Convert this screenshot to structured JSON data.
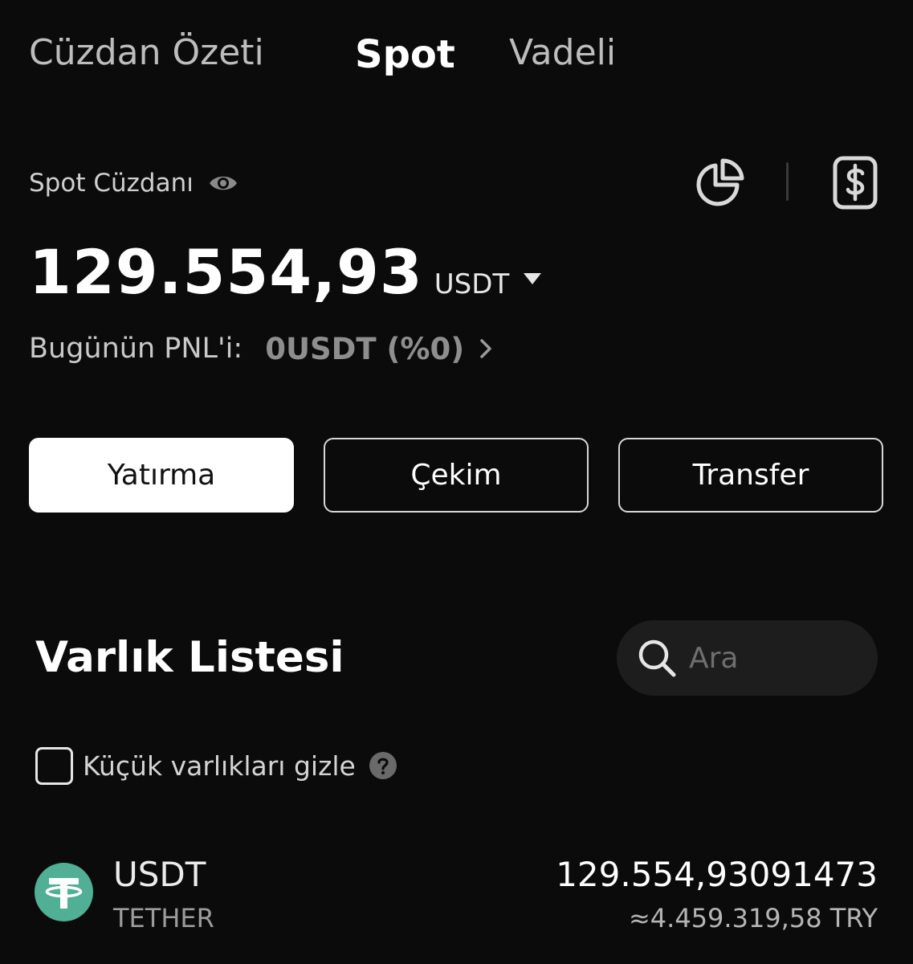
{
  "tabs": [
    {
      "label": "Cüzdan Özeti",
      "active": false
    },
    {
      "label": "Spot",
      "active": true
    },
    {
      "label": "Vadeli",
      "active": false
    }
  ],
  "wallet": {
    "title": "Spot Cüzdanı",
    "balance": "129.554,93",
    "currency": "USDT",
    "pnl_label": "Bugünün PNL'i:",
    "pnl_value": "0USDT (%0)"
  },
  "actions": {
    "deposit": "Yatırma",
    "withdraw": "Çekim",
    "transfer": "Transfer"
  },
  "assets_section": {
    "title": "Varlık Listesi",
    "search_placeholder": "Ara",
    "hide_small_label": "Küçük varlıkları gizle",
    "hide_small_checked": false
  },
  "assets": [
    {
      "symbol": "USDT",
      "name": "TETHER",
      "amount": "129.554,93091473",
      "fiat_value": "≈4.459.319,58 TRY",
      "icon": "tether-icon",
      "icon_color": "#50af95"
    }
  ],
  "icons": {
    "visibility": "eye-icon",
    "portfolio_chart": "pie-chart-icon",
    "balance_card": "dollar-card-icon",
    "currency_select": "caret-down-icon",
    "pnl_details": "chevron-right-icon",
    "search": "search-icon",
    "help": "help-icon"
  },
  "colors": {
    "background": "#0b0b0b",
    "primary_button_bg": "#ffffff",
    "search_bg": "#1d1d1d",
    "muted_text": "#8e8e8e",
    "tether_green": "#50af95"
  }
}
